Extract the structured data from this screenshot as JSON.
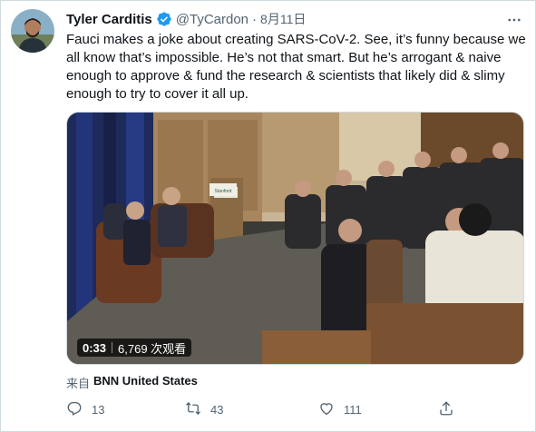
{
  "tweet": {
    "author_name": "Tyler Carditis",
    "handle": "@TyCardon",
    "separator": "·",
    "date": "8月11日",
    "text_lines": [
      "Fauci makes a joke about creating SARS-CoV-2. See, it’s funny because we",
      "all know that’s impossible. He’s not that smart. But he’s arrogant & naive",
      "enough to approve & fund the research & scientists that likely did & slimy",
      "enough to try to cover it all up."
    ],
    "video": {
      "duration": "0:33",
      "views": "6,769 次观看",
      "content_sign": "Stanford"
    },
    "source_prefix": "来自",
    "source_name": "BNN United States",
    "metrics": {
      "replies": "13",
      "retweets": "43",
      "likes": "111"
    },
    "icons": {
      "verified": "verified-badge-icon",
      "more": "more-options-icon",
      "reply": "reply-icon",
      "retweet": "retweet-icon",
      "like": "heart-icon",
      "share": "share-icon"
    },
    "colors": {
      "verified": "#1d9bf0",
      "text": "#0f1419",
      "muted": "#536471",
      "border": "#cfd9de"
    }
  }
}
